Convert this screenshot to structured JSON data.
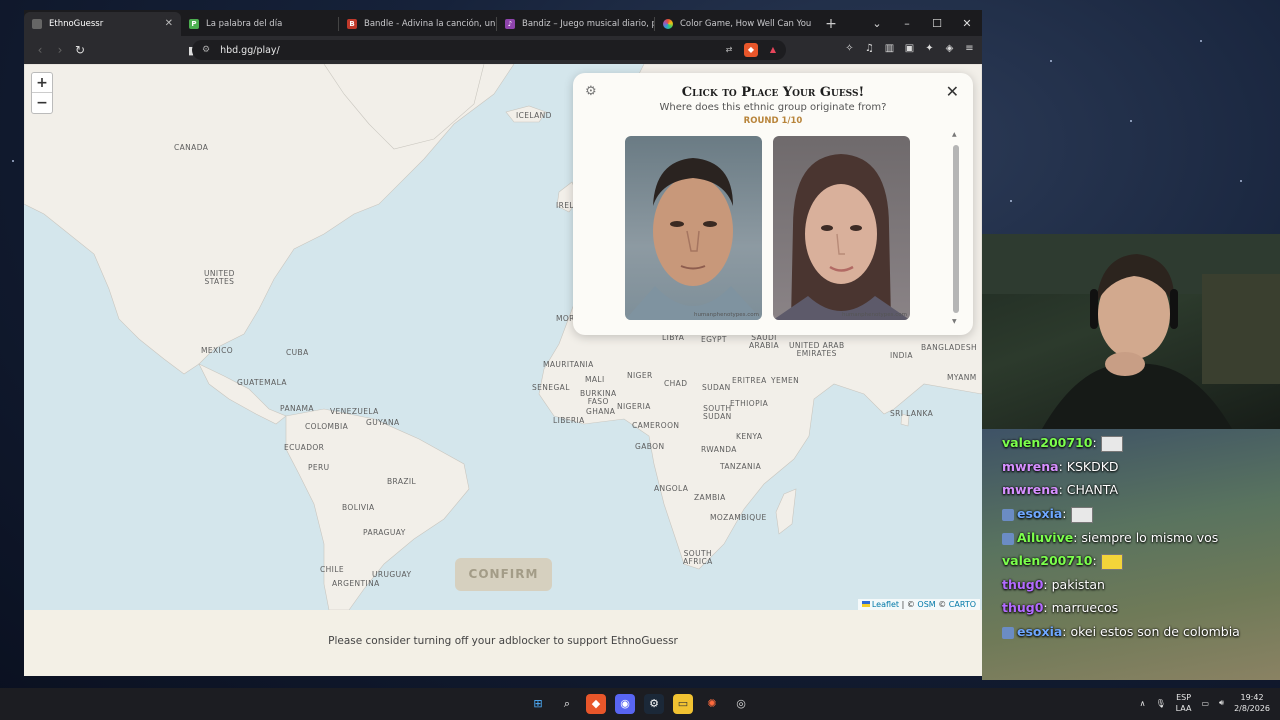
{
  "browser": {
    "tabs": [
      {
        "title": "EthnoGuessr",
        "favicon_color": "#444",
        "active": true
      },
      {
        "title": "La palabra del día",
        "favicon_color": "#4caf50",
        "active": false
      },
      {
        "title": "Bandle - Adivina la canción, un instr",
        "favicon_color": "#c0392b",
        "active": false
      },
      {
        "title": "Bandiz – Juego musical diario, pista",
        "favicon_color": "#8e44ad",
        "active": false
      },
      {
        "title": "Color Game, How Well Can You Re",
        "favicon_color": "#e67e22",
        "active": false
      }
    ],
    "new_tab_label": "+",
    "url": "hbd.gg/play/"
  },
  "map": {
    "zoom_in": "+",
    "zoom_out": "−",
    "labels": {
      "canada": "CANADA",
      "united_states": "UNITED\nSTATES",
      "mexico": "MEXICO",
      "cuba": "CUBA",
      "guatemala": "GUATEMALA",
      "panama": "PANAMA",
      "venezuela": "VENEZUELA",
      "colombia": "COLOMBIA",
      "guyana": "GUYANA",
      "ecuador": "ECUADOR",
      "peru": "PERU",
      "brazil": "BRAZIL",
      "bolivia": "BOLIVIA",
      "paraguay": "PARAGUAY",
      "chile": "CHILE",
      "uruguay": "URUGUAY",
      "argentina": "ARGENTINA",
      "iceland": "ICELAND",
      "ireland": "IREL",
      "morocco": "MOR",
      "mauritania": "MAURITANIA",
      "mali": "MALI",
      "niger": "NIGER",
      "chad": "CHAD",
      "sudan": "SUDAN",
      "senegal": "SENEGAL",
      "burkina_faso": "BURKINA\nFASO",
      "ghana": "GHANA",
      "nigeria": "NIGERIA",
      "liberia": "LIBERIA",
      "cameroon": "CAMEROON",
      "south_sudan": "SOUTH\nSUDAN",
      "ethiopia": "ETHIOPIA",
      "eritrea": "ERITREA",
      "gabon": "GABON",
      "kenya": "KENYA",
      "rwanda": "RWANDA",
      "tanzania": "TANZANIA",
      "angola": "ANGOLA",
      "zambia": "ZAMBIA",
      "mozambique": "MOZAMBIQUE",
      "south_africa": "SOUTH\nAFRICA",
      "libya": "LIBYA",
      "egypt": "EGYPT",
      "saudi_arabia": "SAUDI\nARABIA",
      "uae": "UNITED ARAB\nEMIRATES",
      "yemen": "YEMEN",
      "india": "INDIA",
      "bangladesh": "BANGLADESH",
      "myanmar": "MYANM",
      "sri_lanka": "SRI LANKA"
    },
    "attribution": {
      "leaflet": "Leaflet",
      "sep": " | © ",
      "osm": "OSM",
      "carto_prefix": " © ",
      "carto": "CARTO"
    }
  },
  "panel": {
    "title": "Click to Place Your Guess!",
    "question": "Where does this ethnic group originate from?",
    "round": "ROUND 1/10",
    "close": "✕",
    "watermark": "humanphenotypes.com"
  },
  "confirm_label": "CONFIRM",
  "footer_message": "Please consider turning off your adblocker to support EthnoGuessr",
  "chat": [
    {
      "user": "valen200710",
      "user_color": "#7cff4d",
      "message": "",
      "emote": true
    },
    {
      "user": "mwrena",
      "user_color": "#d690ff",
      "message": "KSKDKD",
      "emote": false
    },
    {
      "user": "mwrena",
      "user_color": "#d690ff",
      "message": "CHANTA",
      "emote": false
    },
    {
      "user": "esoxia",
      "user_color": "#6fa8ff",
      "message": "",
      "emote": true
    },
    {
      "user": "Ailuvive",
      "user_color": "#7cff4d",
      "message": "siempre lo mismo vos",
      "emote": false
    },
    {
      "user": "valen200710",
      "user_color": "#7cff4d",
      "message": "",
      "emote": true
    },
    {
      "user": "thug0",
      "user_color": "#b36bff",
      "message": "pakistan",
      "emote": false
    },
    {
      "user": "thug0",
      "user_color": "#b36bff",
      "message": "marruecos",
      "emote": false
    },
    {
      "user": "esoxia",
      "user_color": "#6fa8ff",
      "message": "okei estos son de colombia",
      "emote": false
    }
  ],
  "taskbar": {
    "lang_top": "ESP",
    "lang_bottom": "LAA",
    "time": "19:42",
    "date": "2/8/2026"
  }
}
